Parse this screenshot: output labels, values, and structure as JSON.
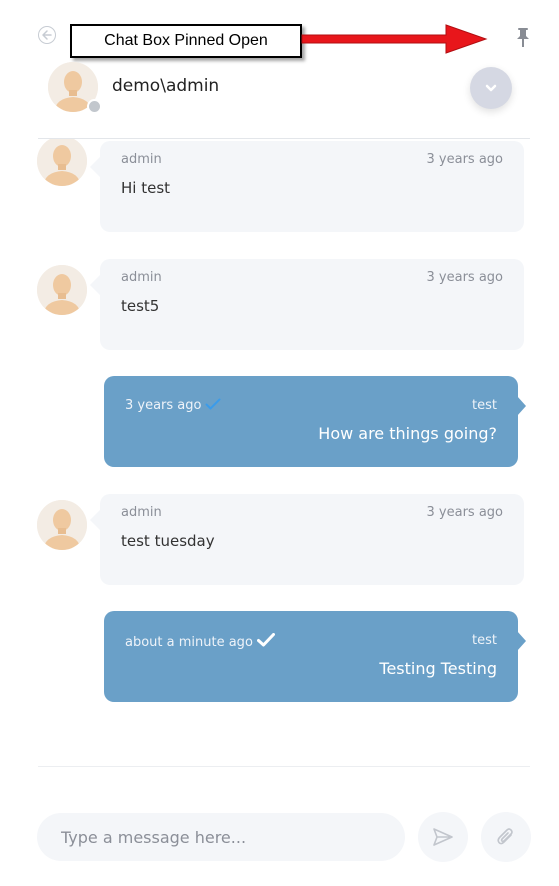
{
  "annotation": {
    "callout_text": "Chat Box Pinned Open"
  },
  "header": {
    "name": "demo\\admin"
  },
  "messages": [
    {
      "direction": "in",
      "sender": "admin",
      "time": "3 years ago",
      "text": "Hi test"
    },
    {
      "direction": "in",
      "sender": "admin",
      "time": "3 years ago",
      "text": "test5"
    },
    {
      "direction": "out",
      "sender": "test",
      "time": "3 years ago",
      "text": "How are things going?",
      "check_color": "#3b9bea"
    },
    {
      "direction": "in",
      "sender": "admin",
      "time": "3 years ago",
      "text": "test tuesday"
    },
    {
      "direction": "out",
      "sender": "test",
      "time": "about a minute ago",
      "text": "Testing Testing",
      "check_color": "#ffffff"
    }
  ],
  "composer": {
    "placeholder": "Type a message here..."
  },
  "colors": {
    "outgoing_bubble": "#6aa0c8",
    "incoming_bubble": "#f4f6f9",
    "arrow": "#e8161b",
    "avatar_bg": "#f3ece4",
    "avatar_face": "#efc9a0"
  },
  "icons": {
    "back": "circle-arrow-left-icon",
    "pin": "pin-icon",
    "collapse": "chevron-down-icon",
    "send": "send-icon",
    "attach": "paperclip-icon"
  }
}
